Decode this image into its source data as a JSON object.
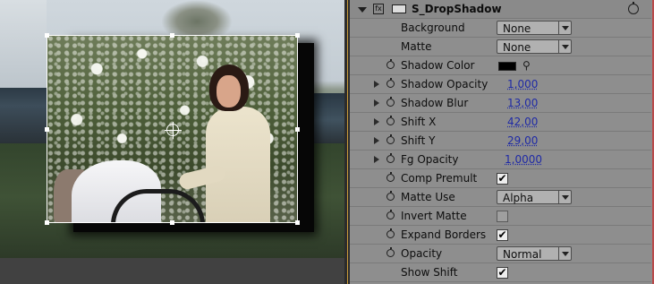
{
  "effect": {
    "name": "S_DropShadow"
  },
  "properties": [
    {
      "label": "Background",
      "type": "dropdown",
      "value": "None"
    },
    {
      "label": "Matte",
      "type": "dropdown",
      "value": "None"
    },
    {
      "label": "Shadow Color",
      "type": "color",
      "value": "#000000"
    },
    {
      "label": "Shadow Opacity",
      "type": "number",
      "value": "1,000"
    },
    {
      "label": "Shadow Blur",
      "type": "number",
      "value": "13,00"
    },
    {
      "label": "Shift X",
      "type": "number",
      "value": "42,00"
    },
    {
      "label": "Shift Y",
      "type": "number",
      "value": "29,00"
    },
    {
      "label": "Fg Opacity",
      "type": "number",
      "value": "1,0000"
    },
    {
      "label": "Comp Premult",
      "type": "checkbox",
      "checked": true
    },
    {
      "label": "Matte Use",
      "type": "dropdown",
      "value": "Alpha"
    },
    {
      "label": "Invert Matte",
      "type": "checkbox",
      "checked": false
    },
    {
      "label": "Expand Borders",
      "type": "checkbox",
      "checked": true
    },
    {
      "label": "Opacity",
      "type": "dropdown",
      "value": "Normal"
    },
    {
      "label": "Show Shift",
      "type": "checkbox",
      "checked": true
    }
  ],
  "checkmark": "✔",
  "icons": {
    "eyedropper": "⚲"
  },
  "colors": {
    "panel_bg": "#8e8e8e",
    "value_link": "#1f2aa6",
    "divider_accent": "#c89a3a",
    "shadow_color": "#000000"
  }
}
